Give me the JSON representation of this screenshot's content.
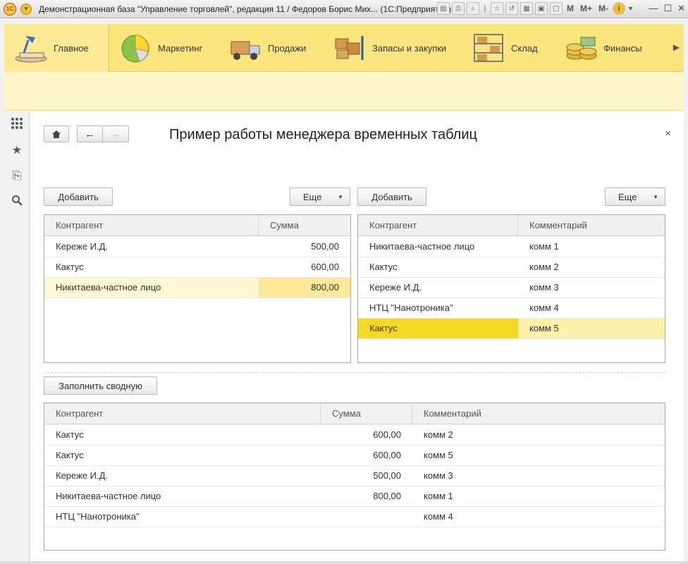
{
  "window": {
    "logo": "1С",
    "title": "Демонстрационная база \"Управление торговлей\", редакция 11 / Федоров Борис Мих...  (1С:Предприятие)",
    "toolbar_text": [
      "M",
      "M+",
      "M-"
    ],
    "info": "i"
  },
  "sections": [
    {
      "label": "Главное",
      "icon": "desk-lamp-icon"
    },
    {
      "label": "Маркетинг",
      "icon": "pie-chart-icon"
    },
    {
      "label": "Продажи",
      "icon": "truck-icon"
    },
    {
      "label": "Запасы и закупки",
      "icon": "boxes-cart-icon"
    },
    {
      "label": "Склад",
      "icon": "warehouse-shelf-icon"
    },
    {
      "label": "Финансы",
      "icon": "coins-icon"
    }
  ],
  "form": {
    "title": "Пример работы менеджера временных таблиц",
    "close": "×"
  },
  "left_table": {
    "add_label": "Добавить",
    "more_label": "Еще",
    "columns": [
      "Контрагент",
      "Сумма"
    ],
    "rows": [
      {
        "contractor": "Кереже И.Д.",
        "sum": "500,00"
      },
      {
        "contractor": "Кактус",
        "sum": "600,00"
      },
      {
        "contractor": "Никитаева-частное лицо",
        "sum": "800,00"
      }
    ]
  },
  "right_table": {
    "add_label": "Добавить",
    "more_label": "Еще",
    "columns": [
      "Контрагент",
      "Комментарий"
    ],
    "rows": [
      {
        "contractor": "Никитаева-частное лицо",
        "comment": "комм 1"
      },
      {
        "contractor": "Кактус",
        "comment": "комм 2"
      },
      {
        "contractor": "Кереже И.Д.",
        "comment": "комм 3"
      },
      {
        "contractor": "НТЦ \"Нанотроника\"",
        "comment": "комм 4"
      },
      {
        "contractor": "Кактус",
        "comment": "комм 5"
      }
    ]
  },
  "summary": {
    "fill_label": "Заполнить сводную",
    "columns": [
      "Контрагент",
      "Сумма",
      "Комментарий"
    ],
    "rows": [
      {
        "contractor": "Кактус",
        "sum": "600,00",
        "comment": "комм 2"
      },
      {
        "contractor": "Кактус",
        "sum": "600,00",
        "comment": "комм 5"
      },
      {
        "contractor": "Кереже И.Д.",
        "sum": "500,00",
        "comment": "комм 3"
      },
      {
        "contractor": "Никитаева-частное лицо",
        "sum": "800,00",
        "comment": "комм 1"
      },
      {
        "contractor": "НТЦ \"Нанотроника\"",
        "sum": "",
        "comment": "комм 4"
      }
    ]
  }
}
